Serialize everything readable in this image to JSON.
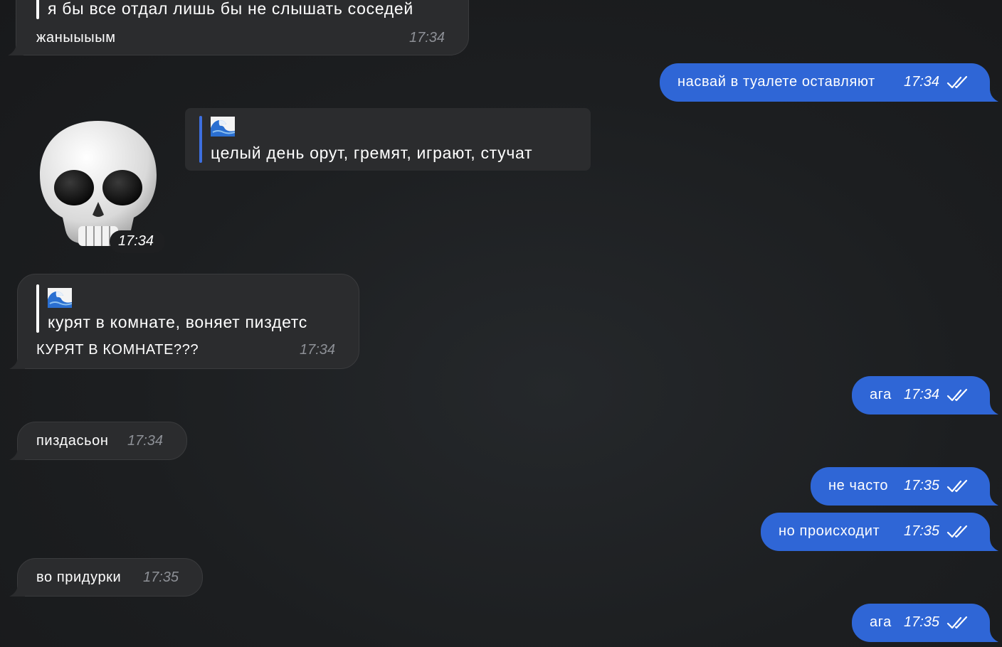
{
  "messages": {
    "m1": {
      "quote": "я бы все отдал лишь бы не слышать соседей",
      "text": "жаныыыым",
      "time": "17:34"
    },
    "m2": {
      "text": "насвай в туалете оставляют",
      "time": "17:34"
    },
    "m3": {
      "quote_emoji_icon": "water-wave-icon",
      "quote": "целый день орут, гремят, играют, стучат"
    },
    "m4": {
      "sticker_icon": "skull-icon",
      "time": "17:34"
    },
    "m5": {
      "quote_emoji_icon": "water-wave-icon",
      "quote": "курят в комнате, воняет пиздетс",
      "text": "КУРЯТ В КОМНАТЕ???",
      "time": "17:34"
    },
    "m6": {
      "text": "ага",
      "time": "17:34"
    },
    "m7": {
      "text": "пиздасьон",
      "time": "17:34"
    },
    "m8": {
      "text": "не часто",
      "time": "17:35"
    },
    "m9": {
      "text": "но происходит",
      "time": "17:35"
    },
    "m10": {
      "text": "во придурки",
      "time": "17:35"
    },
    "m11": {
      "text": "ага",
      "time": "17:35"
    }
  },
  "colors": {
    "background": "#1c1e20",
    "incoming_bubble": "#2b2c2e",
    "outgoing_bubble": "#2f66d6",
    "reply_bar_self": "#ffffff",
    "reply_bar_other": "#3d6fe0",
    "time_incoming": "#8d9096"
  },
  "icons": {
    "read_receipt": "double-check-icon"
  }
}
